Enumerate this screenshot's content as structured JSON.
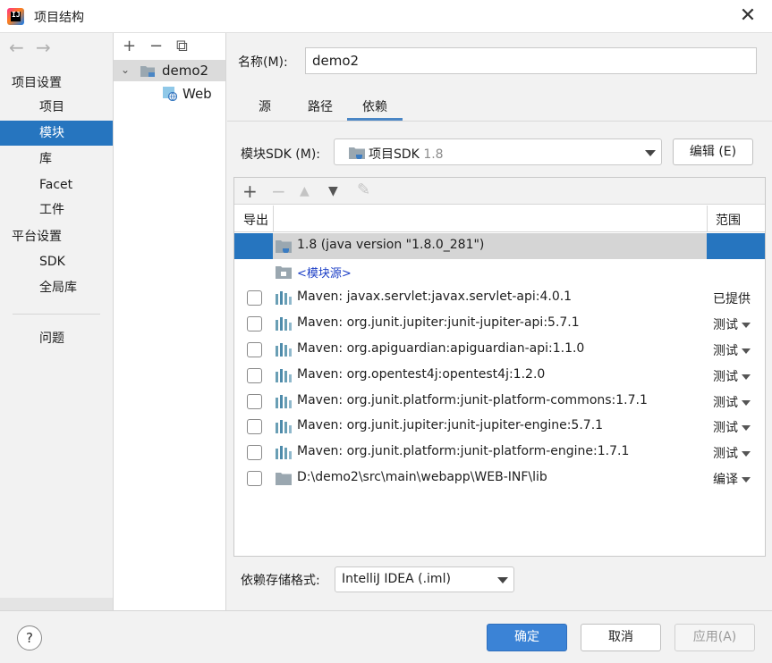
{
  "window": {
    "title": "项目结构",
    "close_glyph": "✕",
    "app_icon_text": "IJ"
  },
  "nav": {
    "back_glyph": "←",
    "forward_glyph": "→",
    "sections": [
      {
        "label": "项目设置"
      },
      {
        "label": "平台设置"
      }
    ],
    "items": [
      {
        "label": "项目"
      },
      {
        "label": "模块"
      },
      {
        "label": "库"
      },
      {
        "label": "Facet"
      },
      {
        "label": "工件"
      },
      {
        "label": "SDK"
      },
      {
        "label": "全局库"
      },
      {
        "label": "问题"
      }
    ],
    "selected": "模块"
  },
  "tree": {
    "toolbar": {
      "add": "+",
      "remove": "−",
      "copy": "⧉"
    },
    "chevron": "⌄",
    "module": "demo2",
    "facet": "Web"
  },
  "module": {
    "name_label": "名称(M):",
    "name_value": "demo2",
    "tabs": [
      {
        "label": "源"
      },
      {
        "label": "路径"
      },
      {
        "label": "依赖"
      }
    ],
    "active_tab": "依赖",
    "sdk_label": "模块SDK (M):",
    "sdk_value": "项目SDK",
    "sdk_version": "1.8",
    "edit_label": "编辑 (E)"
  },
  "deps": {
    "toolbar": {
      "add": "+",
      "remove": "−",
      "up": "▲",
      "down": "▼",
      "edit": "✎"
    },
    "header_export": "导出",
    "header_scope": "范围",
    "rows": [
      {
        "label": "1.8 (java version \"1.8.0_281\")",
        "kind": "sdk",
        "scope": "",
        "selected": true
      },
      {
        "label": "<模块源>",
        "kind": "source",
        "scope": ""
      },
      {
        "label": "Maven: javax.servlet:javax.servlet-api:4.0.1",
        "kind": "maven",
        "scope": "已提供"
      },
      {
        "label": "Maven: org.junit.jupiter:junit-jupiter-api:5.7.1",
        "kind": "maven",
        "scope": "测试"
      },
      {
        "label": "Maven: org.apiguardian:apiguardian-api:1.1.0",
        "kind": "maven",
        "scope": "测试"
      },
      {
        "label": "Maven: org.opentest4j:opentest4j:1.2.0",
        "kind": "maven",
        "scope": "测试"
      },
      {
        "label": "Maven: org.junit.platform:junit-platform-commons:1.7.1",
        "kind": "maven",
        "scope": "测试"
      },
      {
        "label": "Maven: org.junit.jupiter:junit-jupiter-engine:5.7.1",
        "kind": "maven",
        "scope": "测试"
      },
      {
        "label": "Maven: org.junit.platform:junit-platform-engine:1.7.1",
        "kind": "maven",
        "scope": "测试"
      },
      {
        "label": "D:\\demo2\\src\\main\\webapp\\WEB-INF\\lib",
        "kind": "folder",
        "scope": "编译"
      }
    ],
    "format_label": "依赖存储格式:",
    "format_value": "IntelliJ IDEA (.iml)"
  },
  "buttons": {
    "help": "?",
    "ok": "确定",
    "cancel": "取消",
    "apply": "应用(A)"
  },
  "colors": {
    "accent": "#2675bf",
    "primary_button": "#3b83d6",
    "link": "#1c3fc6"
  }
}
